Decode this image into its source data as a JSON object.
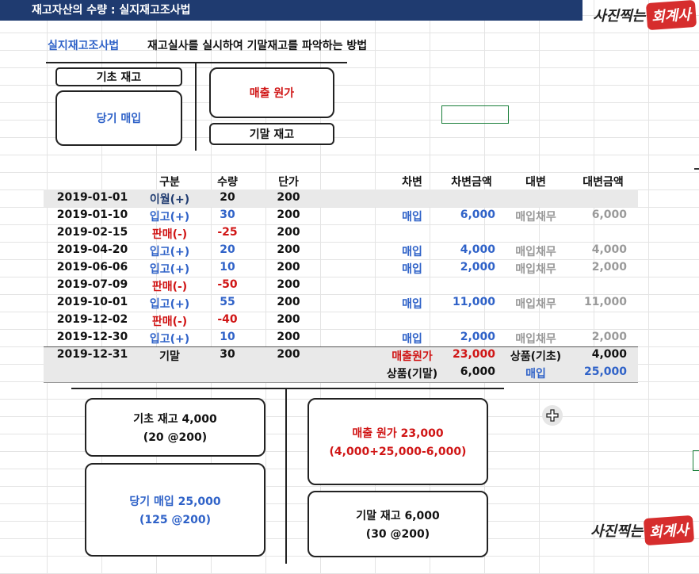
{
  "header": {
    "title": "재고자산의 수량 : 실지재고조사법",
    "logo_top": "사진찍는",
    "logo_top_highlight": "회계사"
  },
  "definition": {
    "term": "실지재고조사법",
    "description": "재고실사를 실시하여 기말재고를 파악하는 방법"
  },
  "top_t_account": {
    "beginning": "기초 재고",
    "purchases": "당기 매입",
    "cogs": "매출 원가",
    "ending": "기말 재고"
  },
  "ledger": {
    "headers": {
      "type": "구분",
      "qty": "수량",
      "price": "단가",
      "debit": "차변",
      "debit_amt": "차변금액",
      "credit": "대변",
      "credit_amt": "대변금액"
    },
    "rows": [
      {
        "date": "2019-01-01",
        "type": "이월(+)",
        "qty": "20",
        "price": "200",
        "debit": "",
        "debit_amt": "",
        "credit": "",
        "credit_amt": "",
        "kind": "carry"
      },
      {
        "date": "2019-01-10",
        "type": "입고(+)",
        "qty": "30",
        "price": "200",
        "debit": "매입",
        "debit_amt": "6,000",
        "credit": "매입채무",
        "credit_amt": "6,000",
        "kind": "in"
      },
      {
        "date": "2019-02-15",
        "type": "판매(-)",
        "qty": "-25",
        "price": "200",
        "debit": "",
        "debit_amt": "",
        "credit": "",
        "credit_amt": "",
        "kind": "out"
      },
      {
        "date": "2019-04-20",
        "type": "입고(+)",
        "qty": "20",
        "price": "200",
        "debit": "매입",
        "debit_amt": "4,000",
        "credit": "매입채무",
        "credit_amt": "4,000",
        "kind": "in"
      },
      {
        "date": "2019-06-06",
        "type": "입고(+)",
        "qty": "10",
        "price": "200",
        "debit": "매입",
        "debit_amt": "2,000",
        "credit": "매입채무",
        "credit_amt": "2,000",
        "kind": "in"
      },
      {
        "date": "2019-07-09",
        "type": "판매(-)",
        "qty": "-50",
        "price": "200",
        "debit": "",
        "debit_amt": "",
        "credit": "",
        "credit_amt": "",
        "kind": "out"
      },
      {
        "date": "2019-10-01",
        "type": "입고(+)",
        "qty": "55",
        "price": "200",
        "debit": "매입",
        "debit_amt": "11,000",
        "credit": "매입채무",
        "credit_amt": "11,000",
        "kind": "in"
      },
      {
        "date": "2019-12-02",
        "type": "판매(-)",
        "qty": "-40",
        "price": "200",
        "debit": "",
        "debit_amt": "",
        "credit": "",
        "credit_amt": "",
        "kind": "out"
      },
      {
        "date": "2019-12-30",
        "type": "입고(+)",
        "qty": "10",
        "price": "200",
        "debit": "매입",
        "debit_amt": "2,000",
        "credit": "매입채무",
        "credit_amt": "2,000",
        "kind": "in"
      },
      {
        "date": "2019-12-31",
        "type": "기말",
        "qty": "30",
        "price": "200",
        "debit": "매출원가",
        "debit_amt": "23,000",
        "credit": "상품(기초)",
        "credit_amt": "4,000",
        "kind": "end"
      },
      {
        "date": "",
        "type": "",
        "qty": "",
        "price": "",
        "debit": "상품(기말)",
        "debit_amt": "6,000",
        "credit": "매입",
        "credit_amt": "25,000",
        "kind": "end2"
      }
    ]
  },
  "bottom_t_account": {
    "beginning_line1": "기초 재고 4,000",
    "beginning_line2": "(20 @200)",
    "purchases_line1": "당기 매입 25,000",
    "purchases_line2": "(125 @200)",
    "cogs_line1": "매출 원가 23,000",
    "cogs_line2": "(4,000+25,000-6,000)",
    "ending_line1": "기말 재고 6,000",
    "ending_line2": "(30 @200)"
  },
  "watermark": {
    "text": "사진찍는",
    "highlight": "회계사"
  },
  "colors": {
    "title_bg": "#1f3b70",
    "blue": "#2f62c8",
    "red": "#d01515",
    "gray": "#9a9a9a",
    "logo_red": "#d62d2d"
  }
}
